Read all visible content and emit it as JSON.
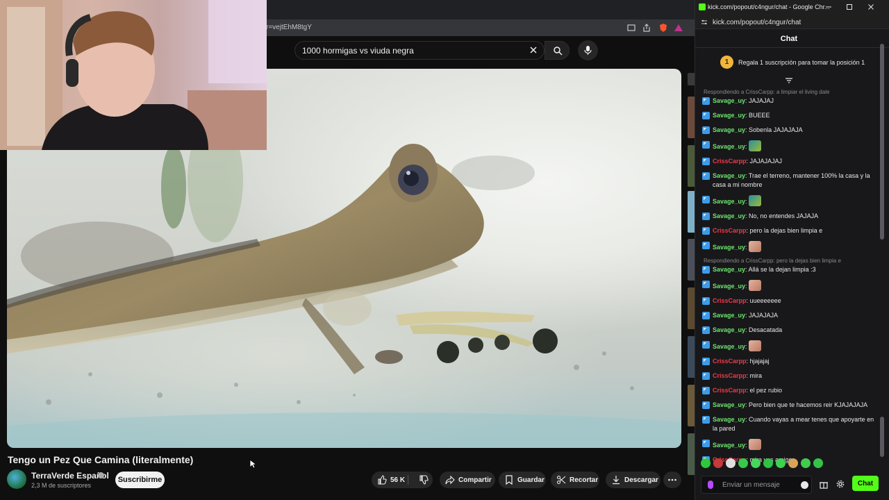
{
  "youtube": {
    "url_fragment": "r=vejtEhM8tgY",
    "search": {
      "value": "1000 hormigas vs viuda negra"
    },
    "video": {
      "title": "Tengo un Pez Que Camina (literalmente)",
      "channel": "TerraVerde Español",
      "subscribers": "2,3 M de suscriptores",
      "subscribe_label": "Suscribirme",
      "likes": "56 K",
      "actions": {
        "share": "Compartir",
        "save": "Guardar",
        "clip": "Recortar",
        "download": "Descargar"
      }
    }
  },
  "kick": {
    "window_title": "kick.com/popout/c4ngur/chat - Google Chr...",
    "url": "kick.com/popout/c4ngur/chat",
    "chat_title": "Chat",
    "pinned": {
      "rank": "1",
      "text": "Regala 1 suscripción para tomar la posición 1"
    },
    "input_placeholder": "Enviar un mensaje",
    "send_label": "Chat",
    "colors": {
      "accent": "#53fc18",
      "user_savage": "#6fe56f",
      "user_criss": "#ee3b48"
    },
    "messages": [
      {
        "reply": "Respondiendo a CrissCarpp: a limpiar el living dale"
      },
      {
        "user": "Savage_uy",
        "text": "JAJAJAJ"
      },
      {
        "user": "Savage_uy",
        "text": "BUEEE"
      },
      {
        "user": "Savage_uy",
        "text": "Sobenla JAJAJAJA"
      },
      {
        "user": "Savage_uy",
        "text": "",
        "emote": "turtle-emote"
      },
      {
        "user": "CrissCarpp",
        "text": "JAJAJAJAJ"
      },
      {
        "user": "Savage_uy",
        "text": "Trae el terreno, mantener 100% la casa y la casa a mi nombre"
      },
      {
        "user": "Savage_uy",
        "text": "",
        "emote": "turtle-emote"
      },
      {
        "user": "Savage_uy",
        "text": "No, no entendes JAJAJA"
      },
      {
        "user": "CrissCarpp",
        "text": "pero la dejas bien limpia e"
      },
      {
        "user": "Savage_uy",
        "text": "",
        "emote": "face-emote"
      },
      {
        "reply": "Respondiendo a CrissCarpp: pero la dejas bien limpia e"
      },
      {
        "user": "Savage_uy",
        "text": "Allá se la dejan limpia :3"
      },
      {
        "user": "Savage_uy",
        "text": "",
        "emote": "face-emote"
      },
      {
        "user": "CrissCarpp",
        "text": "uueeeeeee"
      },
      {
        "user": "Savage_uy",
        "text": "JAJAJAJA"
      },
      {
        "user": "Savage_uy",
        "text": "Desacatada"
      },
      {
        "user": "Savage_uy",
        "text": "",
        "emote": "face-emote"
      },
      {
        "user": "CrissCarpp",
        "text": "hjajajaj"
      },
      {
        "user": "CrissCarpp",
        "text": "mira"
      },
      {
        "user": "CrissCarpp",
        "text": "el pez rubio"
      },
      {
        "user": "Savage_uy",
        "text": "Pero bien que te hacemos reir KJAJAJAJA"
      },
      {
        "user": "Savage_uy",
        "text": "Cuando vayas a mear tenes que apoyarte en la pared"
      },
      {
        "user": "Savage_uy",
        "text": "",
        "emote": "face-emote"
      },
      {
        "user": "CrissCarpp",
        "text": "mira vos amigo"
      }
    ]
  }
}
